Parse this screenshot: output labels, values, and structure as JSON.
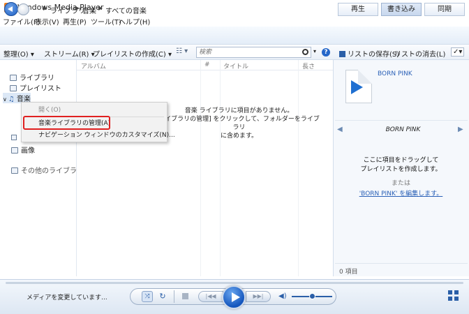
{
  "window": {
    "title": "Windows Media Player",
    "minimize": "—",
    "maximize": "☐",
    "close": "✕"
  },
  "menubar": {
    "file": "ファイル(F)",
    "view": "表示(V)",
    "play": "再生(P)",
    "tools": "ツール(T)",
    "help": "ヘルプ(H)"
  },
  "breadcrumb": [
    "ライブラリ",
    "音楽",
    "すべての音楽"
  ],
  "tabs": {
    "play": "再生",
    "burn": "書き込み",
    "sync": "同期",
    "active": "burn"
  },
  "toolbar": {
    "organize": "整理(O)",
    "stream": "ストリーム(R)",
    "create_playlist": "プレイリストの作成(C)",
    "search_placeholder": "検索",
    "save_list": "リストの保存(S)",
    "clear_list": "リストの消去(L)"
  },
  "columns": {
    "album": "アルバム",
    "number": "#",
    "title": "タイトル",
    "length": "長さ"
  },
  "nav": {
    "library": "ライブラリ",
    "playlists": "プレイリスト",
    "music": "音楽",
    "images": "画像",
    "other_libraries": "その他のライブラリ"
  },
  "empty_message": {
    "line1": "音楽 ライブラリに項目がありません。",
    "line2": "ライブラリの管理] をクリックして、フォルダーをライブラリ",
    "line3": "に含めます。"
  },
  "context_menu": {
    "open": "開く(O)",
    "manage_library": "音楽ライブラリの管理(A)",
    "customize_nav": "ナビゲーション ウィンドウのカスタマイズ(N)..."
  },
  "burn_pane": {
    "playlist_title": "BORN PINK",
    "playlist_name": "BORN PINK",
    "drag_hint_line1": "ここに項目をドラッグして",
    "drag_hint_line2": "プレイリストを作成します。",
    "or": "または",
    "edit_link": "'BORN PINK' を編集します。",
    "item_count": "0 項目"
  },
  "player": {
    "status": "メディアを変更しています...",
    "volume_level": 0.5
  },
  "colors": {
    "accent": "#2b5fa8",
    "highlight_box": "#e02020",
    "link": "#2b61b7"
  }
}
